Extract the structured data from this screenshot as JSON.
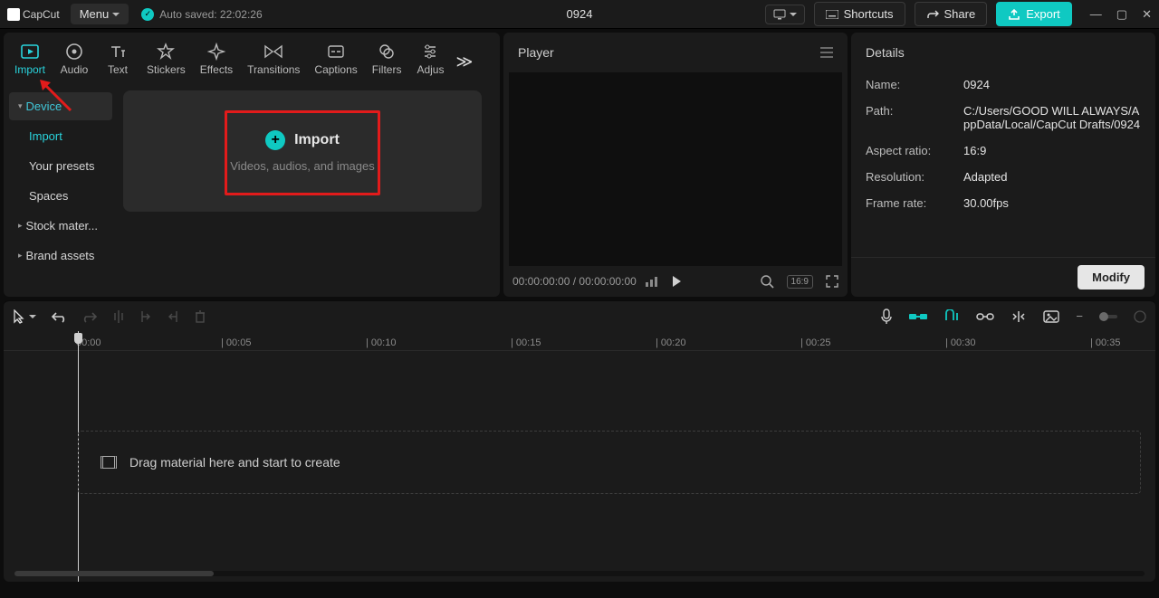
{
  "titlebar": {
    "app_name": "CapCut",
    "menu_label": "Menu",
    "autosave": "Auto saved: 22:02:26",
    "project_title": "0924",
    "shortcuts": "Shortcuts",
    "share": "Share",
    "export": "Export"
  },
  "tabs": {
    "items": [
      "Import",
      "Audio",
      "Text",
      "Stickers",
      "Effects",
      "Transitions",
      "Captions",
      "Filters",
      "Adjus"
    ],
    "active_index": 0,
    "icons": [
      "import",
      "audio",
      "text",
      "stickers",
      "effects",
      "transitions",
      "captions",
      "filters",
      "adjust"
    ]
  },
  "sidebar": {
    "items": [
      {
        "label": "Device",
        "type": "header",
        "caret": "▾"
      },
      {
        "label": "Import",
        "type": "sub",
        "active": true
      },
      {
        "label": "Your presets",
        "type": "sub"
      },
      {
        "label": "Spaces",
        "type": "sub"
      },
      {
        "label": "Stock mater...",
        "type": "header-collapsed",
        "caret": "▸"
      },
      {
        "label": "Brand assets",
        "type": "header-collapsed",
        "caret": "▸"
      }
    ]
  },
  "import_card": {
    "title": "Import",
    "subtitle": "Videos, audios, and images"
  },
  "player": {
    "header": "Player",
    "time_text": "00:00:00:00 / 00:00:00:00",
    "ratio_pill": "16:9"
  },
  "details": {
    "header": "Details",
    "rows": [
      {
        "key": "Name:",
        "val": "0924"
      },
      {
        "key": "Path:",
        "val": "C:/Users/GOOD WILL ALWAYS/AppData/Local/CapCut Drafts/0924"
      },
      {
        "key": "Aspect ratio:",
        "val": "16:9"
      },
      {
        "key": "Resolution:",
        "val": "Adapted"
      },
      {
        "key": "Frame rate:",
        "val": "30.00fps"
      }
    ],
    "modify": "Modify"
  },
  "ruler": {
    "marks": [
      "00:00",
      "| 00:05",
      "| 00:10",
      "| 00:15",
      "| 00:20",
      "| 00:25",
      "| 00:30",
      "| 00:35"
    ]
  },
  "timeline": {
    "drop_hint": "Drag material here and start to create"
  }
}
